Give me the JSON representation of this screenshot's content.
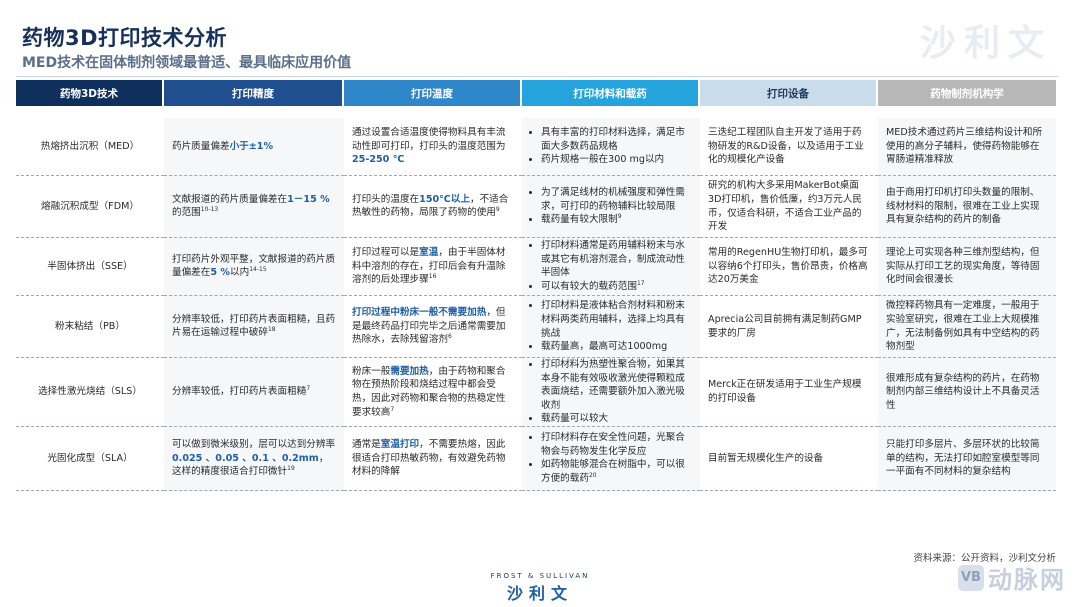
{
  "header": {
    "title": "药物3D打印技术分析",
    "subtitle": "MED技术在固体制剂领域最普适、最具临床应用价值",
    "watermark": "沙利文"
  },
  "table": {
    "columns": [
      "药物3D技术",
      "打印精度",
      "打印温度",
      "打印材料和载药",
      "打印设备",
      "药物制剂机构学"
    ],
    "rows": [
      {
        "name": "热熔挤出沉积（MED）",
        "precision": {
          "pre": "药片质量偏差",
          "hl": "小于±1%",
          "post": ""
        },
        "temperature": {
          "pre": "通过设置合适温度使得物料具有丰流动性即可打印，打印头的温度范围为",
          "hl": "25-250 ℃",
          "post": ""
        },
        "materials": [
          "具有丰富的打印材料选择，满足市面大多数药品规格",
          "药片规格一般在300 mg以内"
        ],
        "device": "三迭纪工程团队自主开发了适用于药物研发的R&D设备，以及适用于工业化的规模化产设备",
        "mechanism": "MED技术通过药片三维结构设计和所使用的高分子辅料，使得药物能够在胃肠道精准释放"
      },
      {
        "name": "熔融沉积成型（FDM）",
        "precision": {
          "pre": "文献报道的药片质量偏差在",
          "hl": "1－15 %",
          "post": "的范围",
          "sup": "10-13"
        },
        "temperature": {
          "pre": "打印头的温度在",
          "hl": "150℃以上",
          "post": "，不适合热敏性的药物，局限了药物的使用",
          "sup": "9"
        },
        "materials": [
          "为了满足线材的机械强度和弹性需求，可打印的药物辅料比较局限",
          "载药量有较大限制"
        ],
        "materials_sup": "9",
        "device": "研究的机构大多采用MakerBot桌面3D打印机，售价低廉，约3万元人民币，仅适合科研，不适合工业产品的开发",
        "mechanism": "由于商用打印机打印头数量的限制、线材材料的限制，很难在工业上实现具有复杂结构的药片的制备"
      },
      {
        "name": "半固体挤出（SSE）",
        "precision": {
          "pre": "打印药片外观平整，文献报道的药片质量偏差在",
          "hl": "5 %",
          "post": "以内",
          "sup": "14-15"
        },
        "temperature": {
          "pre": "打印过程可以是",
          "hl": "室温",
          "post": "，由于半固体材料中溶剂的存在，打印后会有升温除溶剂的后处理步骤",
          "sup": "16"
        },
        "materials": [
          "打印材料通常是药用辅料粉末与水或其它有机溶剂混合，制成流动性半固体",
          "可以有较大的载药范围"
        ],
        "materials_sup": "17",
        "device": "常用的RegenHU生物打印机，最多可以容纳6个打印头，售价昂贵，价格高达20万美金",
        "mechanism": "理论上可实现各种三维剂型结构，但实际从打印工艺的现实角度，等待固化时间会很漫长"
      },
      {
        "name": "粉末粘结（PB）",
        "precision": {
          "pre": "分辨率较低，打印药片表面粗糙，且药片易在运输过程中破碎",
          "hl": "",
          "post": "",
          "sup": "18"
        },
        "temperature": {
          "pre": "",
          "hl": "打印过程中粉床一般不需要加热",
          "post": "，但是最终药品打印完毕之后通常需要加热除水，去除残留溶剂",
          "sup": "6"
        },
        "materials": [
          "打印材料是液体粘合剂材料和粉末材料两类药用辅料，选择上均具有挑战",
          "载药量高，最高可达1000mg"
        ],
        "device": "Aprecia公司目前拥有满足制药GMP要求的厂房",
        "mechanism": "微控释药物具有一定难度，一般用于实验室研究，很难在工业上大规模推广，无法制备例如具有中空结构的药物剂型"
      },
      {
        "name": "选择性激光烧结（SLS）",
        "precision": {
          "pre": "分辨率较低，打印药片表面粗糙",
          "hl": "",
          "post": "",
          "sup": "7"
        },
        "temperature": {
          "pre": "粉床一般",
          "hl": "需要加热",
          "post": "，由于药物和聚合物在预热阶段和烧结过程中都会受热，因此对药物和聚合物的热稳定性要求较高",
          "sup": "7"
        },
        "materials": [
          "打印材料为热塑性聚合物，如果其本身不能有效吸收激光使得颗粒成表面烧结，还需要额外加入激光吸收剂",
          "载药量可以较大"
        ],
        "device": "Merck正在研发适用于工业生产规模的打印设备",
        "mechanism": "很难形成有复杂结构的药片，在药物制剂内部三维结构设计上不具备灵活性"
      },
      {
        "name": "光固化成型（SLA）",
        "precision": {
          "pre": "可以做到微米级别，层可以达到分辨率",
          "hl": "0.025 、0.05 、0.1 、0.2mm",
          "post": "，这样的精度很适合打印微针",
          "sup": "19"
        },
        "temperature": {
          "pre": "通常是",
          "hl": "室温打印",
          "post": "，不需要热熔，因此很适合打印热敏药物，有效避免药物材料的降解"
        },
        "materials": [
          "打印材料存在安全性问题，光聚合物会与药物发生化学反应",
          "如药物能够混合在树脂中，可以很方便的载药"
        ],
        "materials_sup": "20",
        "device": "目前暂无规模化生产的设备",
        "mechanism": "只能打印多层片、多层环状的比较简单的结构，无法打印如腔室模型等同一平面有不同材料的复杂结构"
      }
    ]
  },
  "footer": {
    "source": "资料来源：公开资料，沙利文分析",
    "brand_sub": "FROST & SULLIVAN",
    "brand_logo": "沙利文",
    "corner_badge": "VB",
    "corner_logo": "动脉网"
  }
}
